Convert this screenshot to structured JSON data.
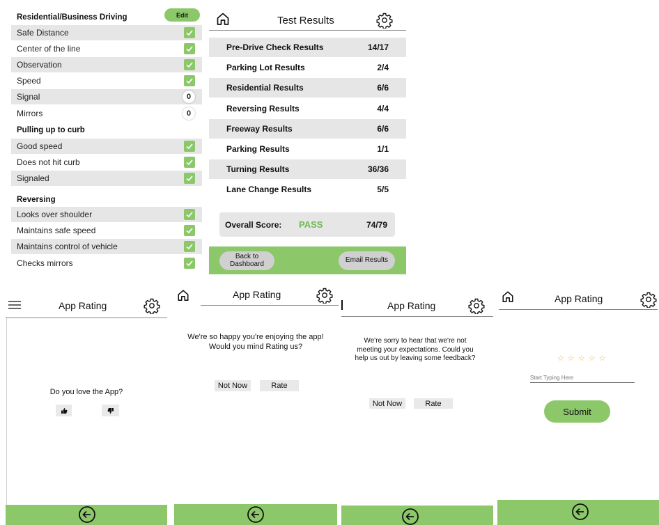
{
  "checklist": {
    "section1_title": "Residential/Business Driving",
    "edit_label": "Edit",
    "section1_items": [
      {
        "label": "Safe Distance",
        "status": "check"
      },
      {
        "label": "Center of the line",
        "status": "check"
      },
      {
        "label": "Observation",
        "status": "check"
      },
      {
        "label": "Speed",
        "status": "check"
      },
      {
        "label": "Signal",
        "status": "0"
      },
      {
        "label": "Mirrors",
        "status": "0"
      }
    ],
    "section2_title": "Pulling up to curb",
    "section2_items": [
      {
        "label": "Good speed",
        "status": "check"
      },
      {
        "label": "Does not hit curb",
        "status": "check"
      },
      {
        "label": "Signaled",
        "status": "check"
      }
    ],
    "section3_title": "Reversing",
    "section3_items": [
      {
        "label": "Looks over shoulder",
        "status": "check"
      },
      {
        "label": "Maintains safe speed",
        "status": "check"
      },
      {
        "label": "Maintains control of vehicle",
        "status": "check"
      },
      {
        "label": "Checks mirrors",
        "status": "check"
      }
    ]
  },
  "results": {
    "title": "Test Results",
    "rows": [
      {
        "label": "Pre-Drive Check Results",
        "score": "14/17"
      },
      {
        "label": "Parking Lot Results",
        "score": "2/4"
      },
      {
        "label": "Residential Results",
        "score": "6/6"
      },
      {
        "label": "Reversing Results",
        "score": "4/4"
      },
      {
        "label": "Freeway Results",
        "score": "6/6"
      },
      {
        "label": "Parking Results",
        "score": "1/1"
      },
      {
        "label": "Turning Results",
        "score": "36/36"
      },
      {
        "label": "Lane Change Results",
        "score": "5/5"
      }
    ],
    "overall_label": "Overall Score:",
    "overall_status": "PASS",
    "overall_score": "74/79",
    "back_label_line1": "Back to",
    "back_label_line2": "Dashboard",
    "email_label": "Email Results"
  },
  "rating1": {
    "title": "App Rating",
    "question": "Do you love the App?"
  },
  "rating2": {
    "title": "App Rating",
    "message_line1": "We're so happy you're enjoying the app!",
    "message_line2": "Would you mind Rating us?",
    "not_now": "Not Now",
    "rate": "Rate"
  },
  "rating3": {
    "title": "App Rating",
    "message_line1": "We're sorry to hear that we're not",
    "message_line2": "meeting your expectations. Could you",
    "message_line3": "help us out by leaving some feedback?",
    "not_now": "Not Now",
    "rate": "Rate"
  },
  "rating4": {
    "title": "App Rating",
    "stars": "☆ ☆ ☆ ☆ ☆",
    "placeholder": "Start Typing Here",
    "submit": "Submit"
  },
  "colors": {
    "accent_green": "#8cc86a",
    "pass_green": "#6dbb4e",
    "row_shade": "#e6e6e6"
  }
}
